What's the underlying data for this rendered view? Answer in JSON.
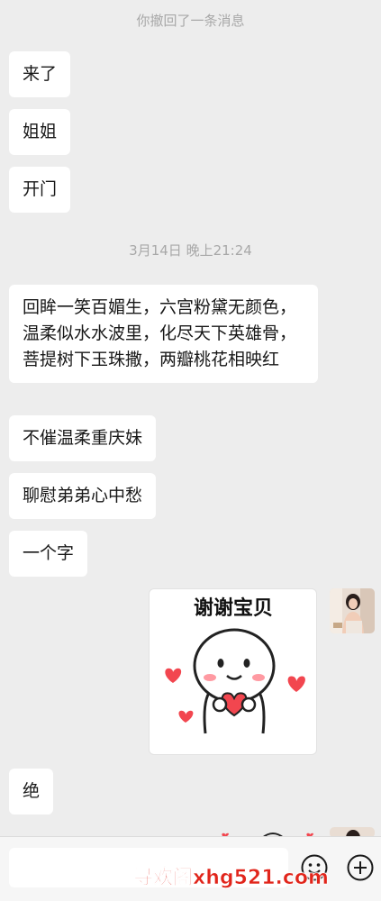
{
  "system_notes": {
    "recalled": "你撤回了一条消息",
    "timestamp": "3月14日 晚上21:24"
  },
  "messages": [
    {
      "text": "来了"
    },
    {
      "text": "姐姐"
    },
    {
      "text": "开门"
    },
    {
      "text": "回眸一笑百媚生，六宫粉黛无颜色，温柔似水水波里，化尽天下英雄骨，菩提树下玉珠撒，两瓣桃花相映红"
    },
    {
      "text": "不催温柔重庆妹"
    },
    {
      "text": "聊慰弟弟心中愁"
    },
    {
      "text": "一个字"
    },
    {
      "text": "绝"
    }
  ],
  "sticker": {
    "caption": "谢谢宝贝",
    "colors": {
      "heart": "#f2464f",
      "blush": "#ff9aa2",
      "outline": "#222222"
    }
  },
  "input_bar": {
    "placeholder": "",
    "emoji_icon": "emoji-icon",
    "plus_icon": "plus-circle-icon"
  },
  "watermark": "寻欢阁xhg521.com"
}
